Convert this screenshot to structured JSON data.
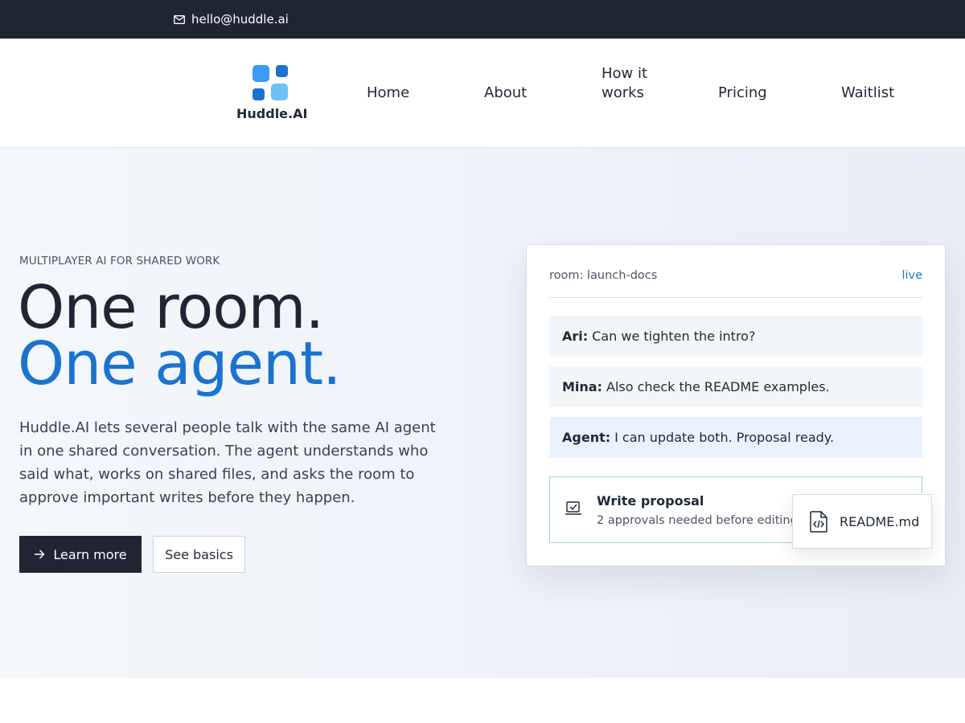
{
  "topbar": {
    "email": "hello@huddle.ai",
    "icon": "mail-icon"
  },
  "brand": {
    "name": "Huddle.AI",
    "logo_colors": [
      "#3b9bf5",
      "#1a73d0",
      "#1a73d0",
      "#6ec1f7"
    ]
  },
  "nav": {
    "items": [
      "Home",
      "About",
      "How it works",
      "Pricing",
      "Waitlist"
    ]
  },
  "hero": {
    "eyebrow": "MULTIPLAYER AI FOR SHARED WORK",
    "headline_line1": "One room.",
    "headline_line2": "One agent.",
    "lead": "Huddle.AI lets several people talk with the same AI agent in one shared conversation. The agent understands who said what, works on shared files, and asks the room to approve important writes before they happen.",
    "primary_button": "Learn more",
    "secondary_button": "See basics"
  },
  "room_card": {
    "room_label": "room: launch-docs",
    "status": "live",
    "messages": [
      {
        "author": "Ari:",
        "text": "Can we tighten the intro?"
      },
      {
        "author": "Mina:",
        "text": "Also check the README examples."
      },
      {
        "author": "Agent:",
        "text": "I can update both. Proposal ready."
      }
    ],
    "proposal": {
      "title": "Write proposal",
      "subtitle": "2 approvals needed before editing"
    },
    "file": {
      "name": "README.md",
      "icon": "code-file-icon"
    }
  },
  "colors": {
    "dark": "#1f2533",
    "accent": "#1a73d0",
    "hero_bg": "#eef3fa"
  }
}
